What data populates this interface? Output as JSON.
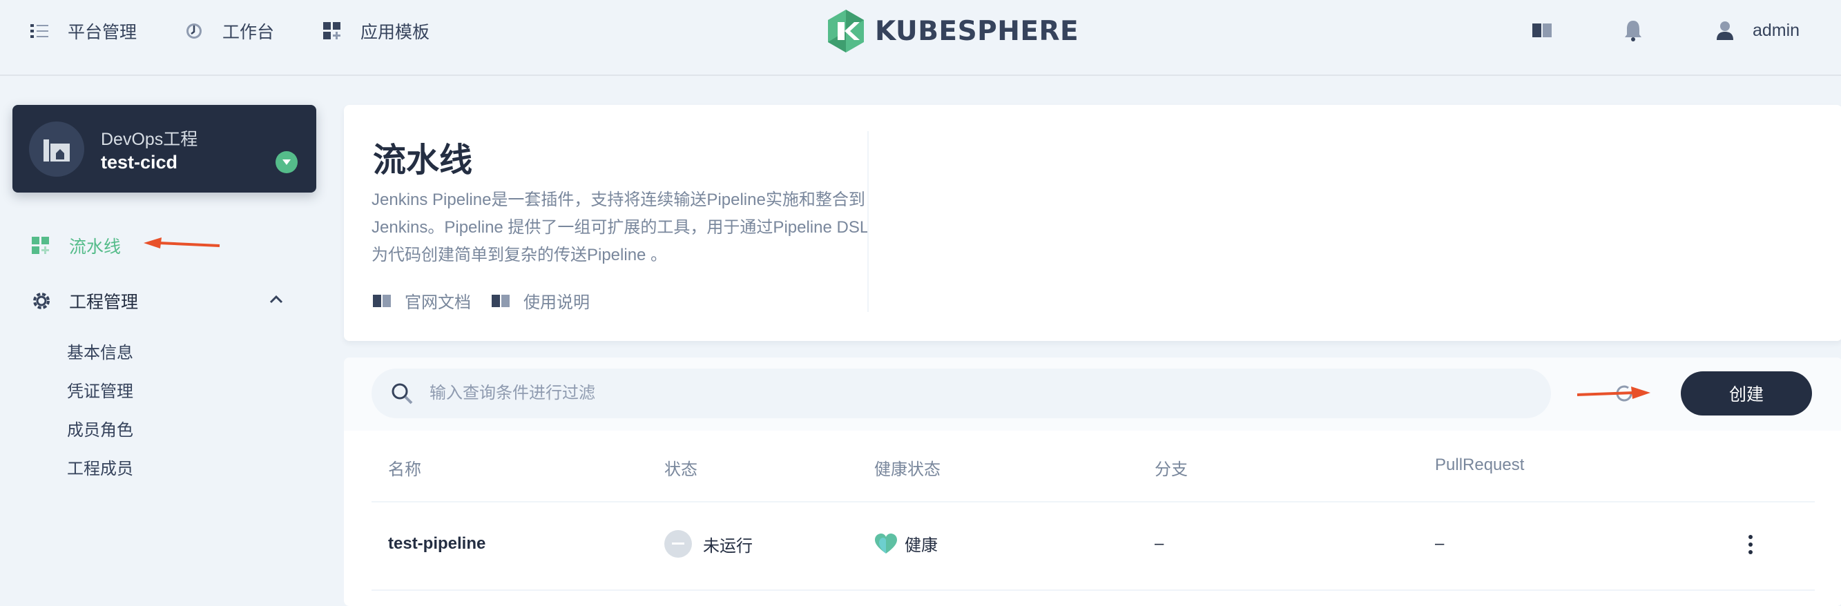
{
  "colors": {
    "dark": "#242e42",
    "green": "#55bc8a",
    "muted": "#79879c",
    "background": "#eff4f9",
    "annotation": "#e8512a"
  },
  "topbar": {
    "nav": [
      {
        "label": "平台管理",
        "icon": "list-icon"
      },
      {
        "label": "工作台",
        "icon": "dashboard-icon"
      },
      {
        "label": "应用模板",
        "icon": "app-grid-icon"
      }
    ],
    "logo_text": "KUBESPHERE",
    "user_name": "admin"
  },
  "sidebar": {
    "project_type": "DevOps工程",
    "project_name": "test-cicd",
    "menu": {
      "pipeline_label": "流水线",
      "project_mgmt_label": "工程管理",
      "project_mgmt_expanded": true,
      "submenu": [
        "基本信息",
        "凭证管理",
        "成员角色",
        "工程成员"
      ]
    }
  },
  "header": {
    "title": "流水线",
    "description": "Jenkins Pipeline是一套插件，支持将连续输送Pipeline实施和整合到Jenkins。Pipeline 提供了一组可扩展的工具，用于通过Pipeline DSL为代码创建简单到复杂的传送Pipeline 。",
    "links": [
      "官网文档",
      "使用说明"
    ]
  },
  "toolbar": {
    "search_placeholder": "输入查询条件进行过滤",
    "create_label": "创建"
  },
  "table": {
    "columns": [
      "名称",
      "状态",
      "健康状态",
      "分支",
      "PullRequest"
    ],
    "rows": [
      {
        "name": "test-pipeline",
        "status": "未运行",
        "health": "健康",
        "branch": "–",
        "pull_request": "–"
      }
    ]
  }
}
